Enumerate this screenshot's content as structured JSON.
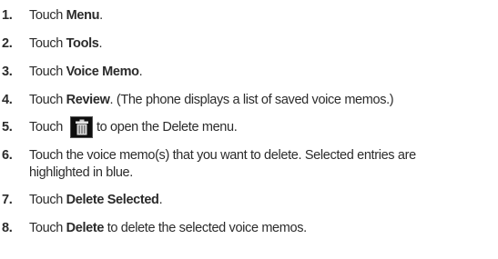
{
  "steps": [
    {
      "number": "1.",
      "pre": "Touch ",
      "bold": "Menu",
      "post": "."
    },
    {
      "number": "2.",
      "pre": "Touch ",
      "bold": "Tools",
      "post": "."
    },
    {
      "number": "3.",
      "pre": "Touch ",
      "bold": "Voice Memo",
      "post": "."
    },
    {
      "number": "4.",
      "pre": "Touch ",
      "bold": "Review",
      "post": ". (The phone displays a list of saved voice memos.)"
    },
    {
      "number": "5.",
      "pre": "Touch",
      "icon": "delete-trash-icon",
      "post": "to open the Delete menu."
    },
    {
      "number": "6.",
      "line1": "Touch the voice memo(s) that you want to delete. Selected entries are",
      "line2": "highlighted in blue."
    },
    {
      "number": "7.",
      "pre": "Touch ",
      "bold": "Delete Selected",
      "post": "."
    },
    {
      "number": "8.",
      "pre": "Touch ",
      "bold": "Delete",
      "post": " to delete the selected voice memos."
    }
  ]
}
